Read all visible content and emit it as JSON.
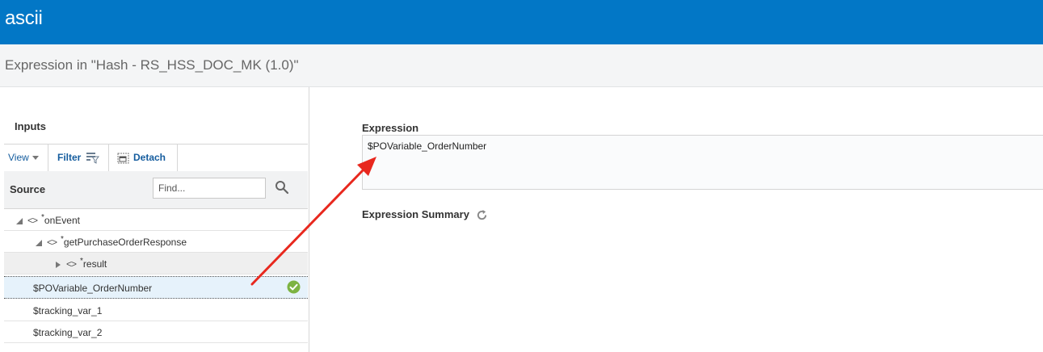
{
  "app": {
    "title": "ascii"
  },
  "header": {
    "expression_title": "Expression in \"Hash - RS_HSS_DOC_MK (1.0)\""
  },
  "inputs": {
    "label": "Inputs",
    "toolbar": {
      "view_label": "View",
      "filter_label": "Filter",
      "detach_label": "Detach"
    },
    "source_label": "Source",
    "find_placeholder": "Find...",
    "tree": [
      {
        "label": "onEvent",
        "required": "*",
        "state": "expanded"
      },
      {
        "label": "getPurchaseOrderResponse",
        "required": "*",
        "state": "expanded"
      },
      {
        "label": "result",
        "required": "*",
        "state": "collapsed"
      },
      {
        "label": "$POVariable_OrderNumber",
        "status": "valid"
      },
      {
        "label": "$tracking_var_1"
      },
      {
        "label": "$tracking_var_2"
      }
    ]
  },
  "expression": {
    "label": "Expression",
    "value": "$POVariable_OrderNumber",
    "summary_label": "Expression Summary"
  },
  "colors": {
    "brand_bar": "#0277c6",
    "selected_row": "#e6f2fb",
    "arrow": "#e8281e",
    "check": "#7cb342"
  },
  "icons": [
    "filter-icon",
    "detach-icon",
    "search-icon",
    "check-icon",
    "refresh-icon",
    "chevron-down-icon",
    "expand-triangle-icon",
    "element-tag-icon"
  ]
}
